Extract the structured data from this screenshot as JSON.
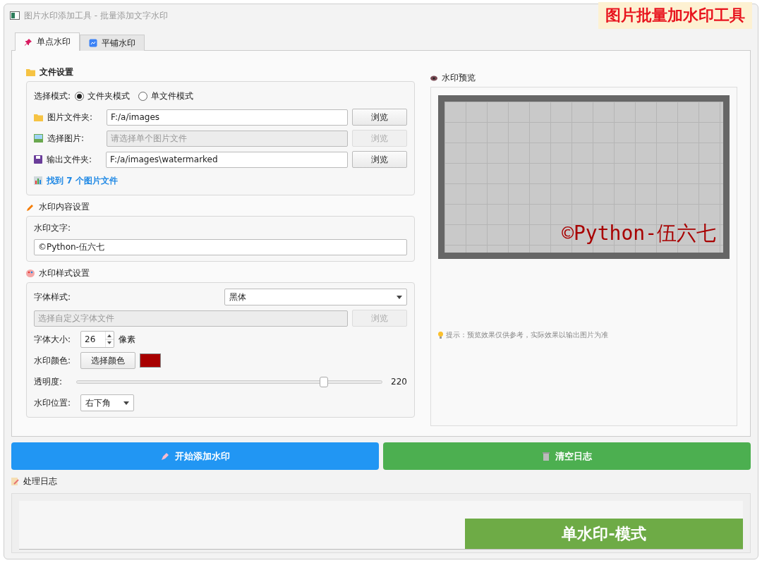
{
  "window": {
    "title": "图片水印添加工具 - 批量添加文字水印"
  },
  "banner": "图片批量加水印工具",
  "tabs": [
    {
      "label": "单点水印",
      "selected": true
    },
    {
      "label": "平铺水印",
      "selected": false
    }
  ],
  "file_settings": {
    "title": "文件设置",
    "mode_label": "选择模式:",
    "modes": [
      {
        "label": "文件夹模式",
        "selected": true
      },
      {
        "label": "单文件模式",
        "selected": false
      }
    ],
    "rows": [
      {
        "label": "图片文件夹:",
        "value": "F:/a/images",
        "button": "浏览",
        "disabled": false
      },
      {
        "label": "选择图片:",
        "placeholder": "请选择单个图片文件",
        "button": "浏览",
        "disabled": true
      },
      {
        "label": "输出文件夹:",
        "value": "F:/a/images\\watermarked",
        "button": "浏览",
        "disabled": false
      }
    ],
    "found": "找到 7 个图片文件"
  },
  "content_settings": {
    "title": "水印内容设置",
    "text_label": "水印文字:",
    "text_value": "©Python-伍六七"
  },
  "style_settings": {
    "title": "水印样式设置",
    "font_label": "字体样式:",
    "font_value": "黑体",
    "custom_font_placeholder": "选择自定义字体文件",
    "custom_font_button": "浏览",
    "custom_font_disabled": true,
    "size_label": "字体大小:",
    "size_value": "26",
    "size_unit": "像素",
    "color_label": "水印颜色:",
    "color_button": "选择颜色",
    "color": "#a80000",
    "opacity_label": "透明度:",
    "opacity": {
      "level": 0.81,
      "reading": "220"
    },
    "position_label": "水印位置:",
    "position_value": "右下角"
  },
  "preview": {
    "title": "水印预览",
    "watermark": "©Python-伍六七",
    "hint": "提示：预览效果仅供参考，实际效果以输出图片为准"
  },
  "actions": [
    {
      "label": "开始添加水印",
      "kind": "start"
    },
    {
      "label": "清空日志",
      "kind": "clear"
    }
  ],
  "log": {
    "title": "处理日志",
    "overlay": "单水印-模式"
  }
}
